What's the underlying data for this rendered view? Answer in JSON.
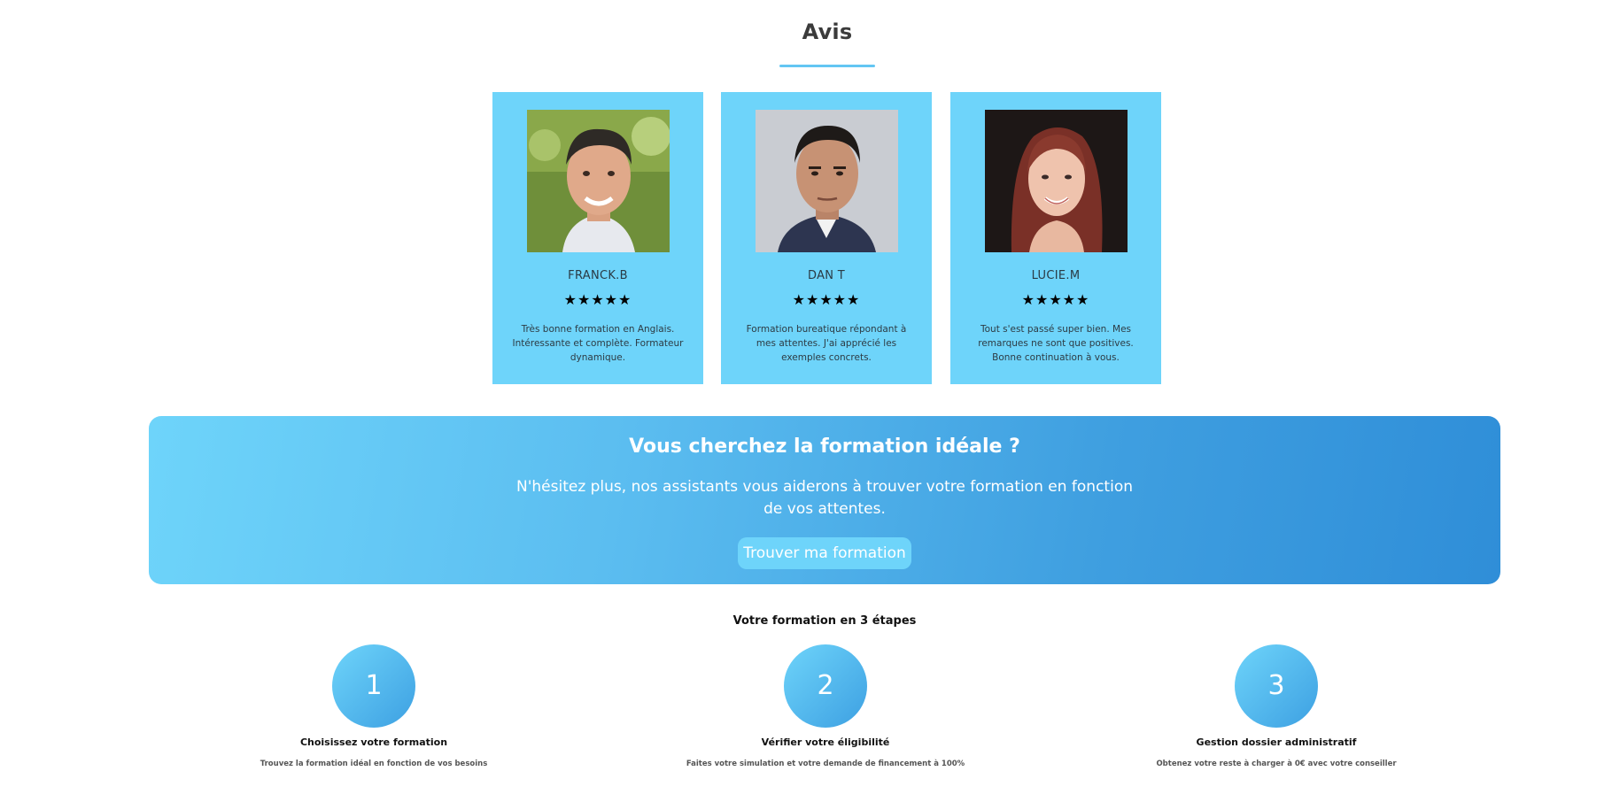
{
  "reviews": {
    "title": "Avis",
    "accent_color": "#63c6f3",
    "card_color": "#6ed4fa",
    "items": [
      {
        "name": "FRANCK.B",
        "rating": 5,
        "stars": "★★★★★",
        "text": "Très bonne formation en Anglais. Intéressante et complète. Formateur dynamique."
      },
      {
        "name": "DAN T",
        "rating": 5,
        "stars": "★★★★★",
        "text": "Formation bureatique répondant à mes attentes. J'ai apprécié les exemples concrets."
      },
      {
        "name": "LUCIE.M",
        "rating": 5,
        "stars": "★★★★★",
        "text": "Tout s'est passé super bien. Mes remarques ne sont que positives. Bonne continuation à vous."
      }
    ]
  },
  "cta": {
    "title": "Vous cherchez la formation idéale ?",
    "text": "N'hésitez plus, nos assistants vous aiderons à trouver votre formation en fonction de vos attentes.",
    "button_label": "Trouver ma formation",
    "gradient_start": "#6ed4fa",
    "gradient_end": "#2f8ed8"
  },
  "steps": {
    "title": "Votre formation en 3 étapes",
    "items": [
      {
        "number": "1",
        "heading": "Choisissez votre formation",
        "description": "Trouvez la formation idéal en fonction de vos besoins"
      },
      {
        "number": "2",
        "heading": "Vérifier votre éligibilité",
        "description": "Faites votre simulation et votre demande de financement à 100%"
      },
      {
        "number": "3",
        "heading": "Gestion dossier administratif",
        "description": "Obtenez votre reste à charger à 0€ avec votre conseiller"
      }
    ]
  }
}
